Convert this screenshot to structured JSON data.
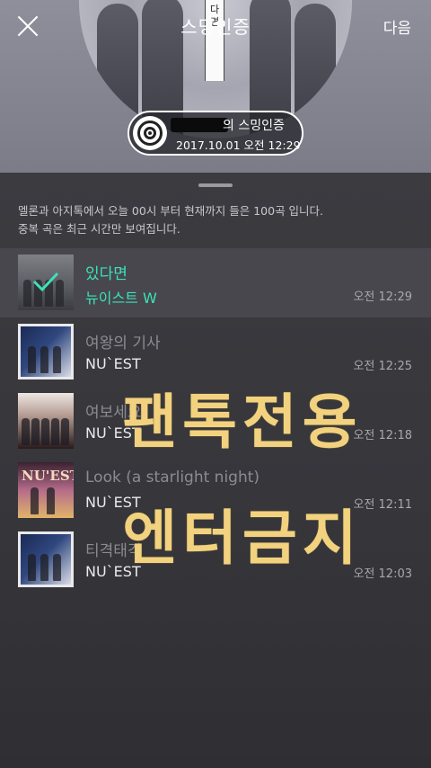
{
  "header": {
    "title": "스밍인증",
    "next_label": "다음",
    "banner_text": "다 면"
  },
  "certificate": {
    "label": "의 스밍인증",
    "date": "2017.10.01 오전 12:29"
  },
  "notice": {
    "line1": "멜론과 아지톡에서 오늘 00시 부터 현재까지 들은 100곡 입니다.",
    "line2": "중복 곡은 최근 시간만 보여집니다."
  },
  "songs": [
    {
      "title": "있다면",
      "artist": "뉴이스트 W",
      "time": "오전 12:29",
      "selected": true
    },
    {
      "title": "여왕의 기사",
      "artist": "NU`EST",
      "time": "오전 12:25",
      "selected": false
    },
    {
      "title": "여보세요",
      "artist": "NU`EST",
      "time": "오전 12:18",
      "selected": false
    },
    {
      "title": "Look (a starlight night)",
      "artist": "NU`EST",
      "time": "오전 12:11",
      "selected": false
    },
    {
      "title": "티격태격",
      "artist": "NU`EST",
      "time": "오전 12:03",
      "selected": false
    }
  ],
  "album_logo_text": "NU'EST",
  "watermark": {
    "line1": "팬톡전용",
    "line2": "엔터금지"
  },
  "colors": {
    "accent": "#3ce2b8",
    "watermark": "#f2d27e"
  }
}
